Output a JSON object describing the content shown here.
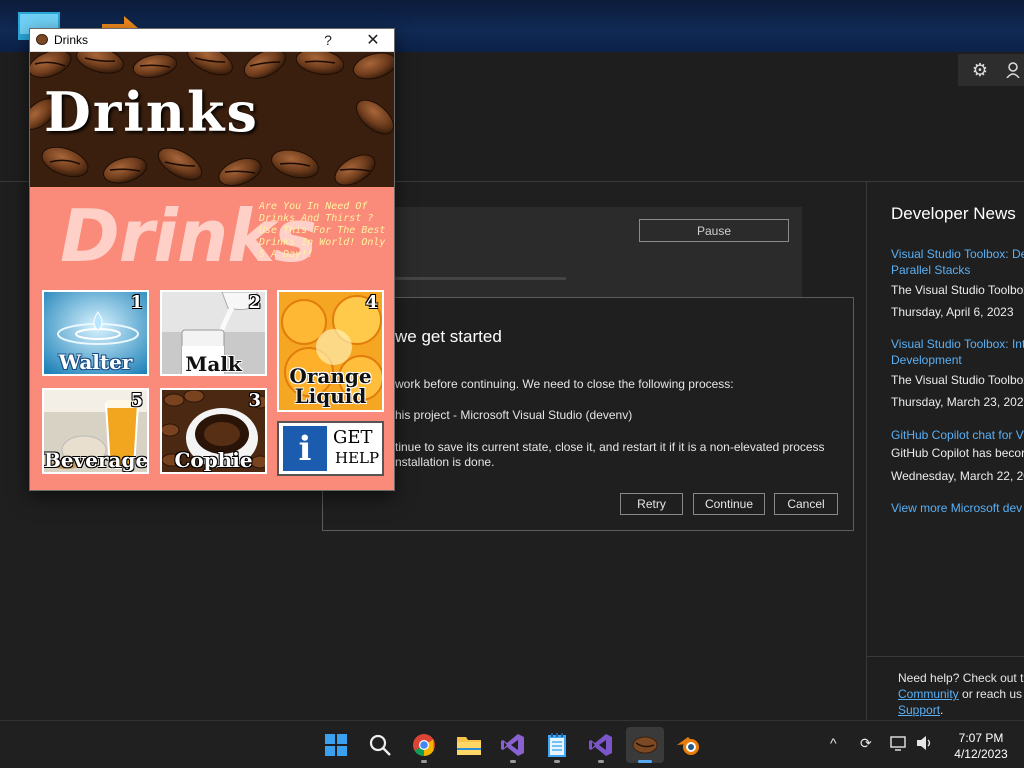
{
  "drinks_window": {
    "title": "Drinks",
    "help_glyph": "?",
    "close_glyph": "✕",
    "banner": "Drinks",
    "background_word": "Drinks",
    "tagline": "Are You In Need Of Drinks And Thirst ? Use This For The Best Drinks In World! Only 5 A Day!!",
    "tiles": [
      {
        "number": "1",
        "name": "Walter"
      },
      {
        "number": "2",
        "name": "Malk"
      },
      {
        "number": "4",
        "name": "Orange Liquid"
      },
      {
        "number": "5",
        "name": "Beverage"
      },
      {
        "number": "3",
        "name": "Cophie"
      }
    ],
    "help_button": {
      "line1": "GET",
      "line2": "HELP",
      "icon_letter": "i"
    }
  },
  "installer": {
    "pause_label": "Pause",
    "progress_fraction": 0.3,
    "dialog_title": "we get started",
    "line1": "work before continuing. We need to close the following process:",
    "line2": "his project - Microsoft Visual Studio (devenv)",
    "line3": "tinue to save its current state, close it, and restart it if it is a non-elevated process",
    "line4": "nstallation is done.",
    "retry_label": "Retry",
    "continue_label": "Continue",
    "cancel_label": "Cancel"
  },
  "news": {
    "title": "Developer News",
    "items": [
      {
        "link1": "Visual Studio Toolbox: De",
        "link2": "Parallel Stacks",
        "text": "The Visual Studio Toolbox",
        "date": "Thursday, April 6, 2023"
      },
      {
        "link1": "Visual Studio Toolbox: Int",
        "link2": "Development",
        "text": "The Visual Studio Toolbox",
        "date": "Thursday, March 23, 2023"
      },
      {
        "link1": "GitHub Copilot chat for V",
        "link2": "",
        "text": "GitHub Copilot has becor",
        "date": "Wednesday, March 22, 20"
      }
    ],
    "more": "View more Microsoft dev"
  },
  "help_box": {
    "line1": "Need help? Check out th",
    "link1": "Community",
    "mid": " or reach us ",
    "link2": "Support",
    "end": "."
  },
  "taskbar": {
    "time": "7:07 PM",
    "date": "4/12/2023"
  },
  "icons": [
    "gear-icon",
    "account-icon",
    "windows-start-icon",
    "search-icon",
    "chrome-icon",
    "file-explorer-icon",
    "visual-studio-preview-icon",
    "notepad-icon",
    "visual-studio-icon",
    "coffee-app-icon",
    "blender-icon",
    "chevron-up-icon",
    "sync-icon",
    "network-icon",
    "volume-icon"
  ]
}
